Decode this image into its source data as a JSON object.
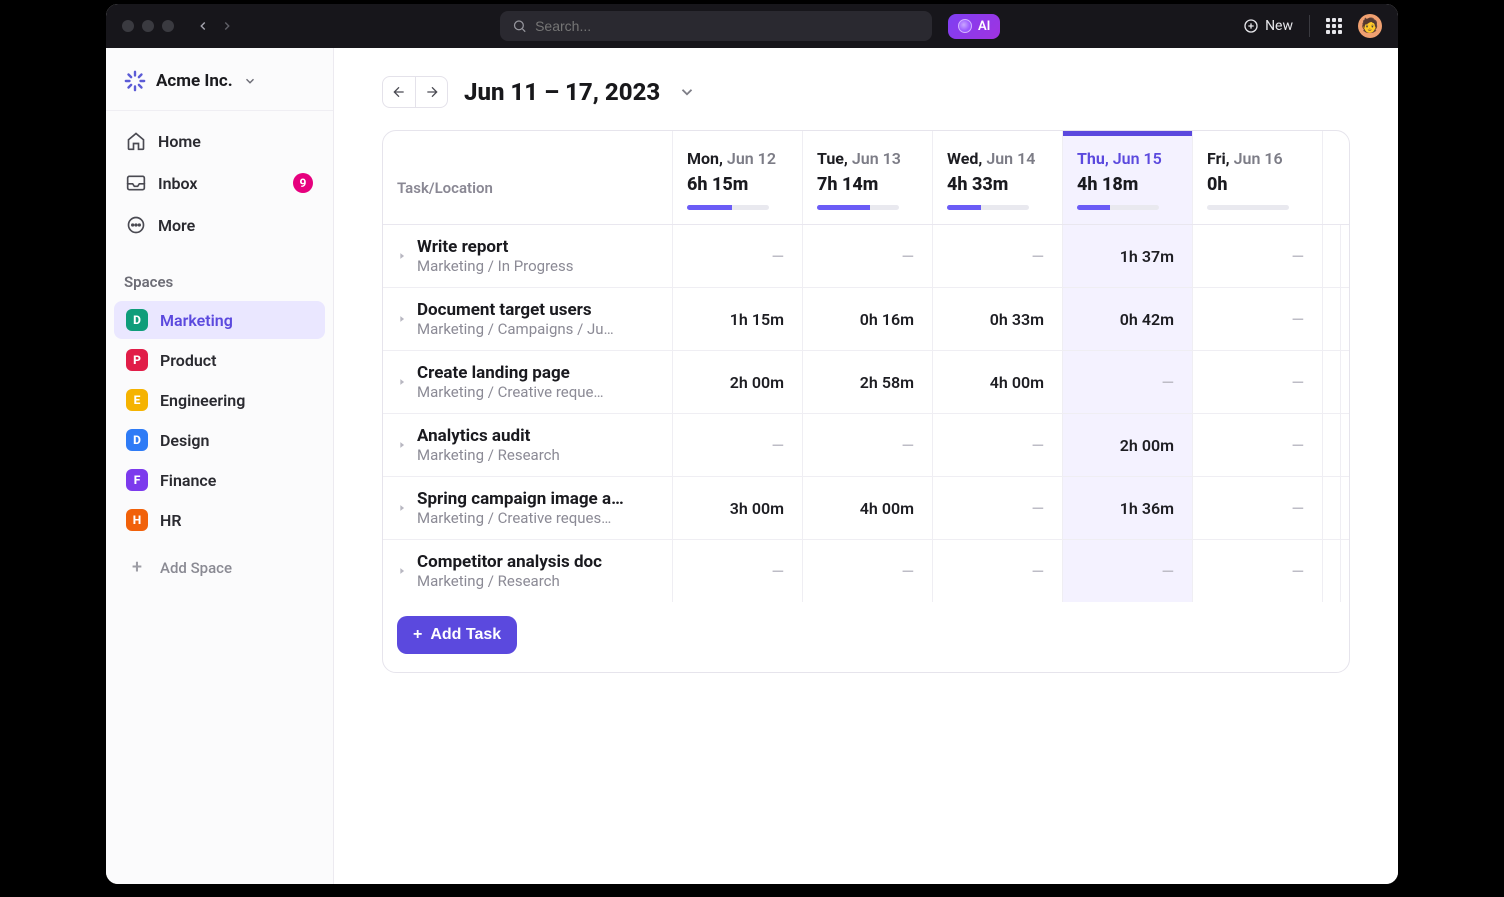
{
  "topbar": {
    "search_placeholder": "Search...",
    "ai_label": "AI",
    "new_label": "New"
  },
  "workspace": {
    "name": "Acme Inc."
  },
  "nav": {
    "home": "Home",
    "inbox": "Inbox",
    "inbox_badge": "9",
    "more": "More"
  },
  "spaces_label": "Spaces",
  "spaces": [
    {
      "letter": "D",
      "name": "Marketing",
      "color": "#0f9d7a"
    },
    {
      "letter": "P",
      "name": "Product",
      "color": "#e11d48"
    },
    {
      "letter": "E",
      "name": "Engineering",
      "color": "#f5b301"
    },
    {
      "letter": "D",
      "name": "Design",
      "color": "#2e7bf6"
    },
    {
      "letter": "F",
      "name": "Finance",
      "color": "#7c3aed"
    },
    {
      "letter": "H",
      "name": "HR",
      "color": "#f1610a"
    }
  ],
  "add_space_label": "Add Space",
  "range_title": "Jun 11 – 17, 2023",
  "columns_header": "Task/Location",
  "days": [
    {
      "dow": "Mon",
      "date": "Jun 12",
      "total": "6h 15m",
      "progress": 55,
      "active": false
    },
    {
      "dow": "Tue",
      "date": "Jun 13",
      "total": "7h 14m",
      "progress": 65,
      "active": false
    },
    {
      "dow": "Wed",
      "date": "Jun 14",
      "total": "4h 33m",
      "progress": 42,
      "active": false
    },
    {
      "dow": "Thu",
      "date": "Jun 15",
      "total": "4h 18m",
      "progress": 40,
      "active": true
    },
    {
      "dow": "Fri",
      "date": "Jun 16",
      "total": "0h",
      "progress": 0,
      "active": false
    }
  ],
  "tasks": [
    {
      "name": "Write report",
      "path": "Marketing / In Progress",
      "cells": [
        "—",
        "—",
        "—",
        "1h  37m",
        "—"
      ]
    },
    {
      "name": "Document target users",
      "path": "Marketing / Campaigns / Ju…",
      "cells": [
        "1h 15m",
        "0h 16m",
        "0h 33m",
        "0h 42m",
        "—"
      ]
    },
    {
      "name": "Create landing page",
      "path": "Marketing / Creative reque…",
      "cells": [
        "2h 00m",
        "2h 58m",
        "4h 00m",
        "—",
        "—"
      ]
    },
    {
      "name": "Analytics audit",
      "path": "Marketing / Research",
      "cells": [
        "—",
        "—",
        "—",
        "2h 00m",
        "—"
      ]
    },
    {
      "name": "Spring campaign image a…",
      "path": "Marketing / Creative reques…",
      "cells": [
        "3h 00m",
        "4h 00m",
        "—",
        "1h 36m",
        "—"
      ]
    },
    {
      "name": "Competitor analysis doc",
      "path": "Marketing / Research",
      "cells": [
        "—",
        "—",
        "—",
        "—",
        "—"
      ]
    }
  ],
  "add_task_label": "Add Task"
}
